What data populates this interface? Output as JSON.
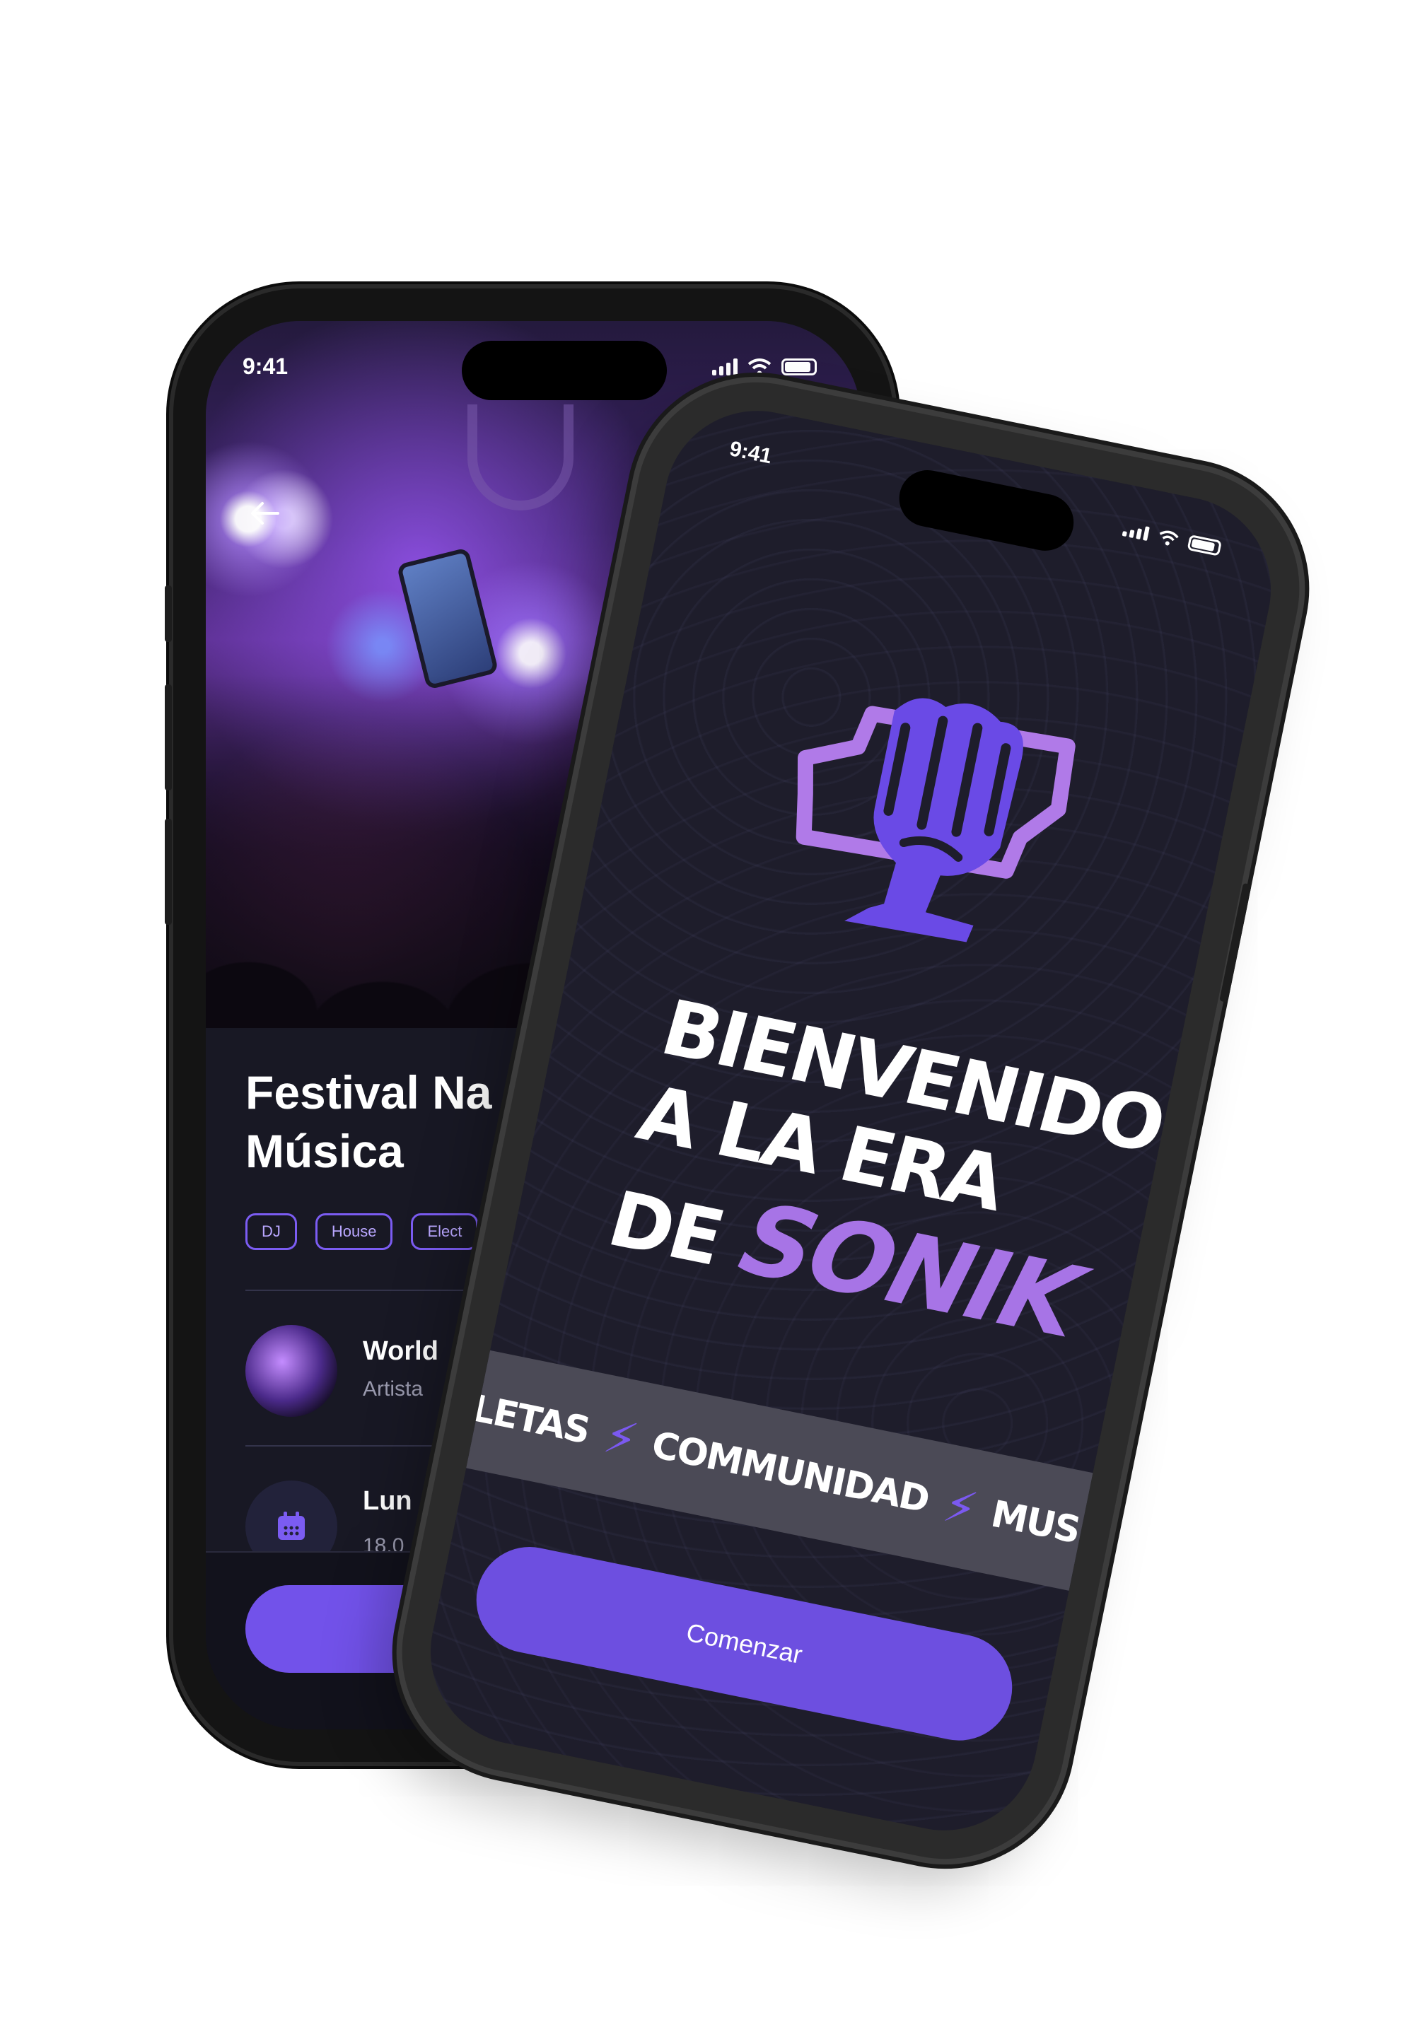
{
  "back_phone": {
    "status": {
      "time": "9:41"
    },
    "event": {
      "title_line1": "Festival Na",
      "title_line2": "Música",
      "tags": [
        "DJ",
        "House",
        "Elect"
      ]
    },
    "artist": {
      "name": "World",
      "subtitle": "Artista"
    },
    "date": {
      "day": "Lun",
      "time": "18.0"
    }
  },
  "front_phone": {
    "status": {
      "time": "9:41"
    },
    "welcome": {
      "line1": "BIENVENIDO",
      "line2": "A LA ERA",
      "line3_prefix": "DE",
      "brand": "SONIK"
    },
    "band_items": [
      "BOLETAS",
      "COMMUNIDAD",
      "MUSICA"
    ],
    "cta_label": "Comenzar"
  },
  "icons": [
    "arrow-left-icon",
    "calendar-icon",
    "fist-money-logo-icon",
    "bolt-icon",
    "signal-icon",
    "wifi-icon",
    "battery-icon"
  ],
  "colors": {
    "accent": "#7252ea",
    "brand_text": "#a774e6",
    "screen_bg": "#1e1d2b"
  }
}
